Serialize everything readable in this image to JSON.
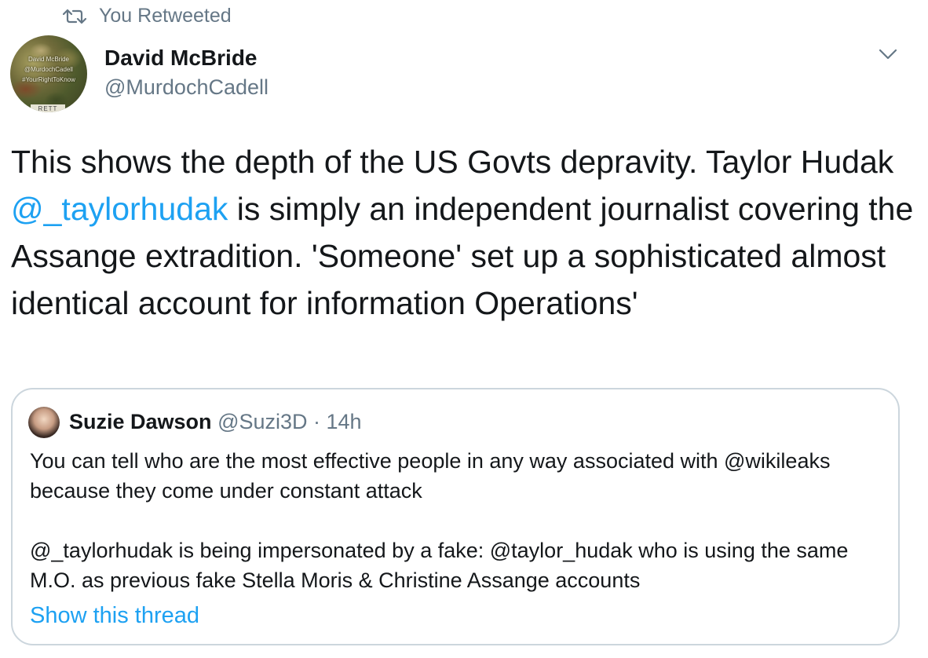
{
  "retweet": {
    "label": "You Retweeted",
    "icon": "retweet-icon"
  },
  "author": {
    "name": "David McBride",
    "handle": "@MurdochCadell",
    "avatar_lines": [
      "David McBride",
      "@MurdochCadell",
      "#YourRightToKnow"
    ],
    "avatar_band": "RETT"
  },
  "menu": {
    "icon": "chevron-down-icon"
  },
  "tweet": {
    "text_before": "This shows the depth of the US Govts depravity. Taylor Hudak ",
    "mention": "@_taylorhudak",
    "text_after": " is simply an independent journalist covering the Assange extradition. 'Someone' set up a sophisticated almost identical account for information Operations'"
  },
  "quote": {
    "name": "Suzie Dawson",
    "handle": "@Suzi3D",
    "separator": " · ",
    "time": "14h",
    "paragraph1": "You can tell who are the most effective people in any way associated with @wikileaks because they come under constant attack",
    "paragraph2": "@_taylorhudak is being impersonated by a fake: @taylor_hudak who is using the same M.O. as previous fake Stella Moris & Christine Assange accounts",
    "show_thread": "Show this thread"
  },
  "colors": {
    "text": "#14171a",
    "secondary": "#657786",
    "link": "#1da1f2",
    "border": "#ccd6dd"
  }
}
